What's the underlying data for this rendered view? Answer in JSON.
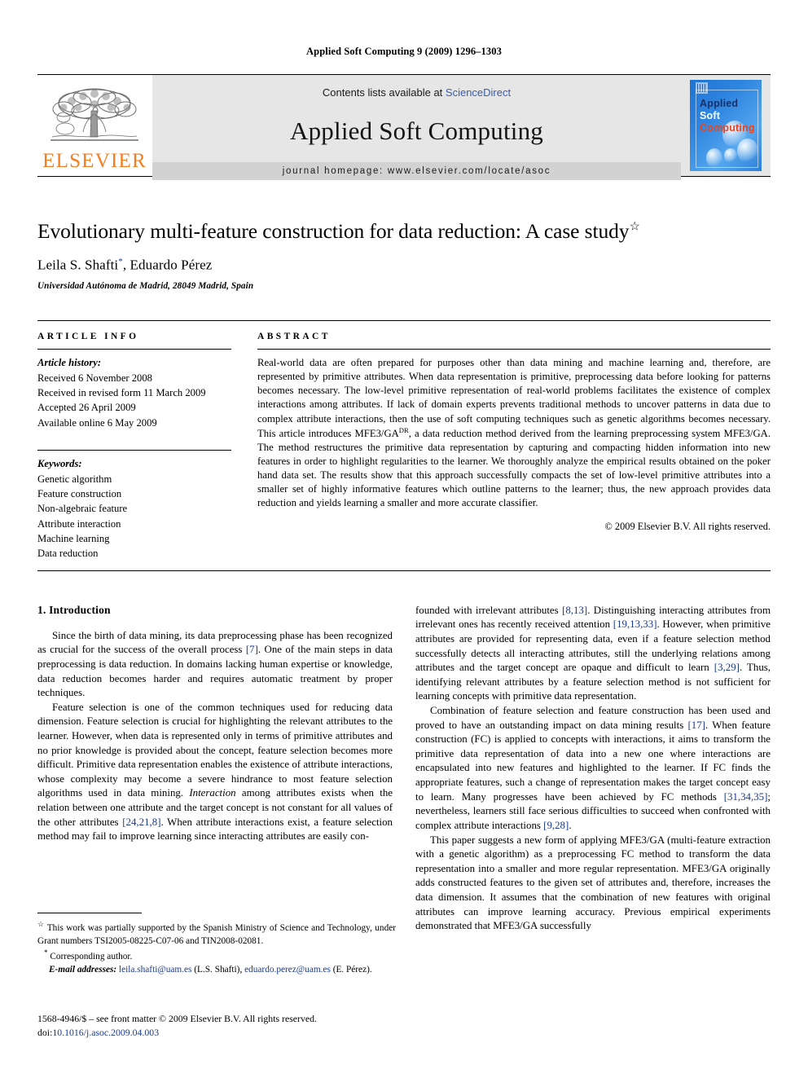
{
  "running_head": "Applied Soft Computing 9 (2009) 1296–1303",
  "masthead": {
    "publisher_name": "ELSEVIER",
    "contents_prefix": "Contents lists available at ",
    "sciencedirect": "ScienceDirect",
    "journal_name": "Applied Soft Computing",
    "homepage": "journal homepage: www.elsevier.com/locate/asoc",
    "cover": {
      "line1": "Applied",
      "line2": "Soft",
      "line3": "Computing",
      "color_applied": "#16306b",
      "color_soft": "#ffffff",
      "color_computing": "#e8451f",
      "background": "#2f86e0"
    },
    "sciencedirect_color": "#3b5ca8",
    "elsevier_orange": "#F47D20",
    "band_gray": "#e6e6e6"
  },
  "title_block": {
    "title": "Evolutionary multi-feature construction for data reduction: A case study",
    "title_footnote_marker": "☆",
    "authors_before": "Leila S. Shafti",
    "corresponding_marker": "*",
    "authors_after": ", Eduardo Pérez",
    "affiliation": "Universidad Autónoma de Madrid, 28049 Madrid, Spain"
  },
  "article_info": {
    "label": "ARTICLE INFO",
    "history_label": "Article history:",
    "history": [
      "Received 6 November 2008",
      "Received in revised form 11 March 2009",
      "Accepted 26 April 2009",
      "Available online 6 May 2009"
    ],
    "keywords_label": "Keywords:",
    "keywords": [
      "Genetic algorithm",
      "Feature construction",
      "Non-algebraic feature",
      "Attribute interaction",
      "Machine learning",
      "Data reduction"
    ]
  },
  "abstract": {
    "label": "ABSTRACT",
    "part1": "Real-world data are often prepared for purposes other than data mining and machine learning and, therefore, are represented by primitive attributes. When data representation is primitive, preprocessing data before looking for patterns becomes necessary. The low-level primitive representation of real-world problems facilitates the existence of complex interactions among attributes. If lack of domain experts prevents traditional methods to uncover patterns in data due to complex attribute interactions, then the use of soft computing techniques such as genetic algorithms becomes necessary. This article introduces MFE3/GA",
    "superscript": "DR",
    "part2": ", a data reduction method derived from the learning preprocessing system MFE3/GA. The method restructures the primitive data representation by capturing and compacting hidden information into new features in order to highlight regularities to the learner. We thoroughly analyze the empirical results obtained on the poker hand data set. The results show that this approach successfully compacts the set of low-level primitive attributes into a smaller set of highly informative features which outline patterns to the learner; thus, the new approach provides data reduction and yields learning a smaller and more accurate classifier.",
    "copyright": "© 2009 Elsevier B.V. All rights reserved."
  },
  "body": {
    "section_heading": "1. Introduction",
    "left_paragraphs": [
      {
        "segments": [
          {
            "t": "Since the birth of data mining, its data preprocessing phase has been recognized as crucial for the success of the overall process "
          },
          {
            "t": "[7]",
            "ref": true
          },
          {
            "t": ". One of the main steps in data preprocessing is data reduction. In domains lacking human expertise or knowledge, data reduction becomes harder and requires automatic treatment by proper techniques."
          }
        ]
      },
      {
        "segments": [
          {
            "t": "Feature selection is one of the common techniques used for reducing data dimension. Feature selection is crucial for highlighting the relevant attributes to the learner. However, when data is represented only in terms of primitive attributes and no prior knowledge is provided about the concept, feature selection becomes more difficult. Primitive data representation enables the existence of attribute interactions, whose complexity may become a severe hindrance to most feature selection algorithms used in data mining. "
          },
          {
            "t": "Interaction",
            "ital": true
          },
          {
            "t": " among attributes exists when the relation between one attribute and the target concept is not constant for all values of the other attributes "
          },
          {
            "t": "[24,21,8]",
            "ref": true
          },
          {
            "t": ". When attribute interactions exist, a feature selection method may fail to improve learning since interacting attributes are easily con-"
          }
        ]
      }
    ],
    "right_paragraphs": [
      {
        "continuation": true,
        "segments": [
          {
            "t": "founded with irrelevant attributes "
          },
          {
            "t": "[8,13]",
            "ref": true
          },
          {
            "t": ". Distinguishing interacting attributes from irrelevant ones has recently received attention "
          },
          {
            "t": "[19,13,33]",
            "ref": true
          },
          {
            "t": ". However, when primitive attributes are provided for representing data, even if a feature selection method successfully detects all interacting attributes, still the underlying relations among attributes and the target concept are opaque and difficult to learn "
          },
          {
            "t": "[3,29]",
            "ref": true
          },
          {
            "t": ". Thus, identifying relevant attributes by a feature selection method is not sufficient for learning concepts with primitive data representation."
          }
        ]
      },
      {
        "segments": [
          {
            "t": "Combination of feature selection and feature construction has been used and proved to have an outstanding impact on data mining results "
          },
          {
            "t": "[17]",
            "ref": true
          },
          {
            "t": ". When feature construction (FC) is applied to concepts with interactions, it aims to transform the primitive data representation of data into a new one where interactions are encapsulated into new features and highlighted to the learner. If FC finds the appropriate features, such a change of representation makes the target concept easy to learn. Many progresses have been achieved by FC methods "
          },
          {
            "t": "[31,34,35]",
            "ref": true
          },
          {
            "t": "; nevertheless, learners still face serious difficulties to succeed when confronted with complex attribute interactions "
          },
          {
            "t": "[9,28]",
            "ref": true
          },
          {
            "t": "."
          }
        ]
      },
      {
        "segments": [
          {
            "t": "This paper suggests a new form of applying MFE3/GA (multi-feature extraction with a genetic algorithm) as a preprocessing FC method to transform the data representation into a smaller and more regular representation. MFE3/GA originally adds constructed features to the given set of attributes and, therefore, increases the data dimension. It assumes that the combination of new features with original attributes can improve learning accuracy. Previous empirical experiments demonstrated that MFE3/GA successfully"
          }
        ]
      }
    ]
  },
  "footnotes": {
    "grant_marker": "☆",
    "grant": "This work was partially supported by the Spanish Ministry of Science and Technology, under Grant numbers TSI2005-08225-C07-06 and TIN2008-02081.",
    "corresponding_marker": "*",
    "corresponding": "Corresponding author.",
    "email_label": "E-mail addresses:",
    "email1": "leila.shafti@uam.es",
    "email1_owner": "(L.S. Shafti),",
    "email2": "eduardo.perez@uam.es",
    "email2_owner": "(E. Pérez)."
  },
  "imprint": {
    "line1": "1568-4946/$ – see front matter © 2009 Elsevier B.V. All rights reserved.",
    "doi_label": "doi:",
    "doi_value": "10.1016/j.asoc.2009.04.003"
  }
}
